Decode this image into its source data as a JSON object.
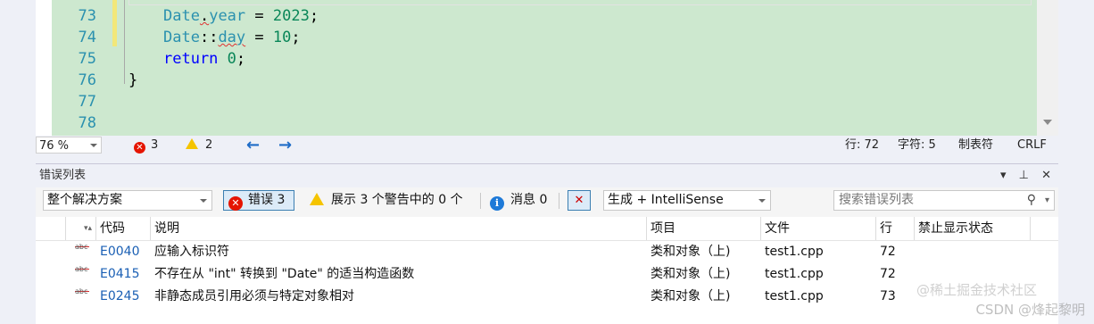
{
  "editor": {
    "lines": [
      {
        "num": "73"
      },
      {
        "num": "74"
      },
      {
        "num": "75"
      },
      {
        "num": "76"
      },
      {
        "num": "77"
      },
      {
        "num": "78"
      }
    ],
    "code73_type": "Date",
    "code73_dot": ".",
    "code73_member": "year",
    "code73_rest": " = ",
    "code73_num": "2023",
    "code73_end": ";",
    "code74_type": "Date",
    "code74_sep": "::",
    "code74_member": "day",
    "code74_rest": " = ",
    "code74_num": "10",
    "code74_end": ";",
    "code75_kw": "return",
    "code75_num": "0",
    "code75_end": ";",
    "code76": "}"
  },
  "status": {
    "zoom": "76 %",
    "errors": "3",
    "warnings": "2",
    "back": "←",
    "forward": "→",
    "line": "行: 72",
    "char": "字符: 5",
    "tabs": "制表符",
    "eol": "CRLF"
  },
  "panel": {
    "title": "错误列表",
    "scope": "整个解决方案",
    "errors_btn": "错误 3",
    "warnings_btn": "展示 3 个警告中的 0 个",
    "messages_btn": "消息 0",
    "build_filter": "生成 + IntelliSense",
    "search_placeholder": "搜索错误列表",
    "headers": {
      "code": "代码",
      "desc": "说明",
      "project": "项目",
      "file": "文件",
      "line": "行",
      "suppress": "禁止显示状态"
    },
    "rows": [
      {
        "code": "E0040",
        "desc": "应输入标识符",
        "project": "类和对象（上)",
        "file": "test1.cpp",
        "line": "72"
      },
      {
        "code": "E0415",
        "desc": "不存在从 \"int\" 转换到 \"Date\" 的适当构造函数",
        "project": "类和对象（上)",
        "file": "test1.cpp",
        "line": "72"
      },
      {
        "code": "E0245",
        "desc": "非静态成员引用必须与特定对象相对",
        "project": "类和对象（上)",
        "file": "test1.cpp",
        "line": "73"
      }
    ]
  },
  "watermark": "@稀土掘金技术社区",
  "watermark2": "CSDN @烽起黎明"
}
